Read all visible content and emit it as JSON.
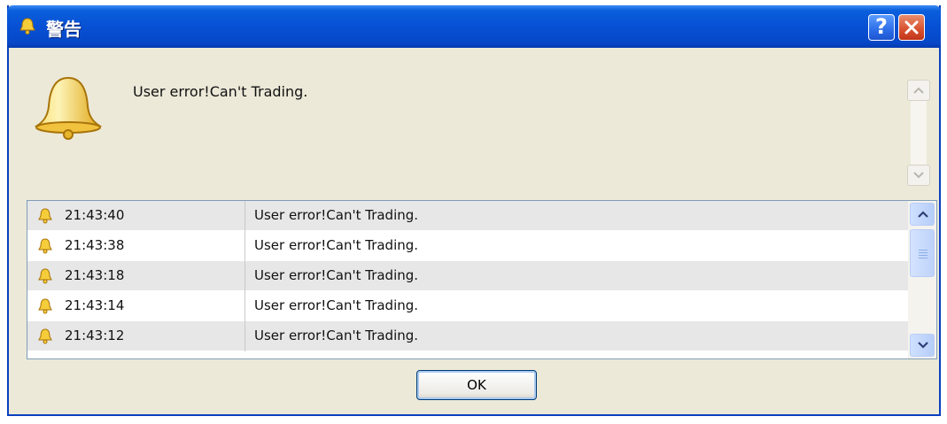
{
  "window": {
    "title": "警告"
  },
  "titlebar_buttons": {
    "help_label": "?",
    "close_icon": "close-icon"
  },
  "alert": {
    "message": "User error!Can't Trading.",
    "icon": "bell-icon"
  },
  "log": {
    "rows": [
      {
        "time": "21:43:40",
        "text": "User error!Can't Trading."
      },
      {
        "time": "21:43:38",
        "text": "User error!Can't Trading."
      },
      {
        "time": "21:43:18",
        "text": "User error!Can't Trading."
      },
      {
        "time": "21:43:14",
        "text": "User error!Can't Trading."
      },
      {
        "time": "21:43:12",
        "text": "User error!Can't Trading."
      }
    ]
  },
  "actions": {
    "ok_label": "OK"
  },
  "colors": {
    "titlebar": "#0750d4",
    "dialog_bg": "#ece9d8",
    "close": "#d8502d",
    "bell": "#f2c531"
  }
}
